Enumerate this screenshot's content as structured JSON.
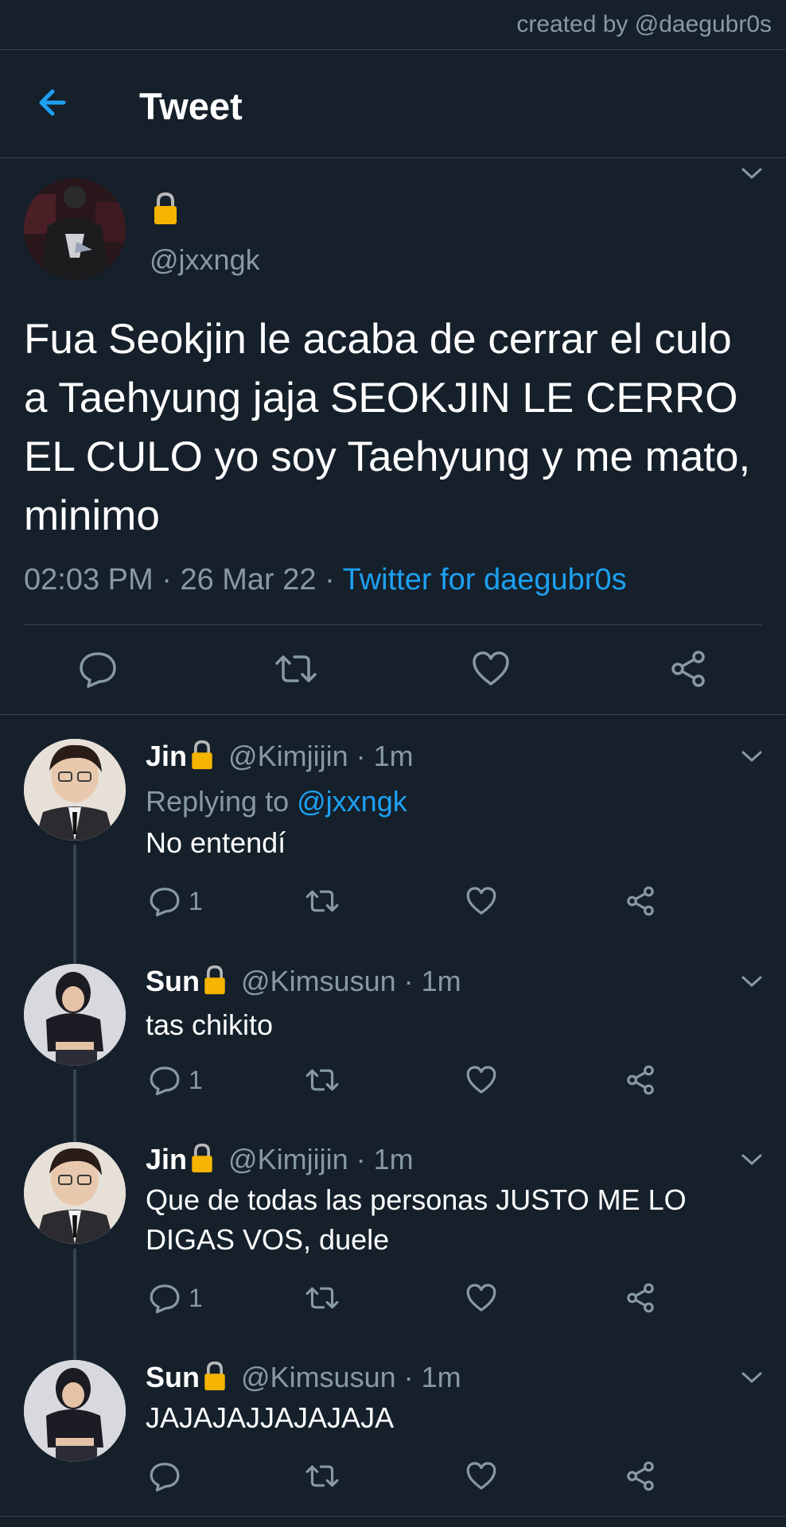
{
  "credit": "created by @daegubr0s",
  "header": {
    "title": "Tweet"
  },
  "main_tweet": {
    "handle": "@jxxngk",
    "text": "Fua Seokjin le acaba de cerrar el culo a Taehyung jaja SEOKJIN LE CERRO EL CULO yo soy Taehyung y me mato, minimo",
    "time": "02:03 PM",
    "date": "26 Mar 22",
    "separator": "·",
    "source": "Twitter for daegubr0s"
  },
  "replies": [
    {
      "name": "Jin",
      "handle": "@Kimjijin",
      "time": "1m",
      "replying_prefix": "Replying to",
      "replying_to": "@jxxngk",
      "text": "No entendí",
      "reply_count": "1"
    },
    {
      "name": "Sun",
      "handle": "@Kimsusun",
      "time": "1m",
      "text": "tas chikito",
      "reply_count": "1"
    },
    {
      "name": "Jin",
      "handle": "@Kimjijin",
      "time": "1m",
      "text": "Que de todas las personas JUSTO ME LO DIGAS VOS, duele",
      "reply_count": "1"
    },
    {
      "name": "Sun",
      "handle": "@Kimsusun",
      "time": "1m",
      "text": "JAJAJAJJAJAJAJA",
      "reply_count": ""
    }
  ],
  "icons": [
    "arrow-left-icon",
    "lock-icon",
    "chevron-down-icon",
    "reply-icon",
    "retweet-icon",
    "like-icon",
    "share-icon"
  ],
  "colors": {
    "background": "#15202b",
    "accent": "#1da1f2",
    "muted": "#8899a6",
    "divider": "#38444d",
    "lock": "#f5b400"
  }
}
